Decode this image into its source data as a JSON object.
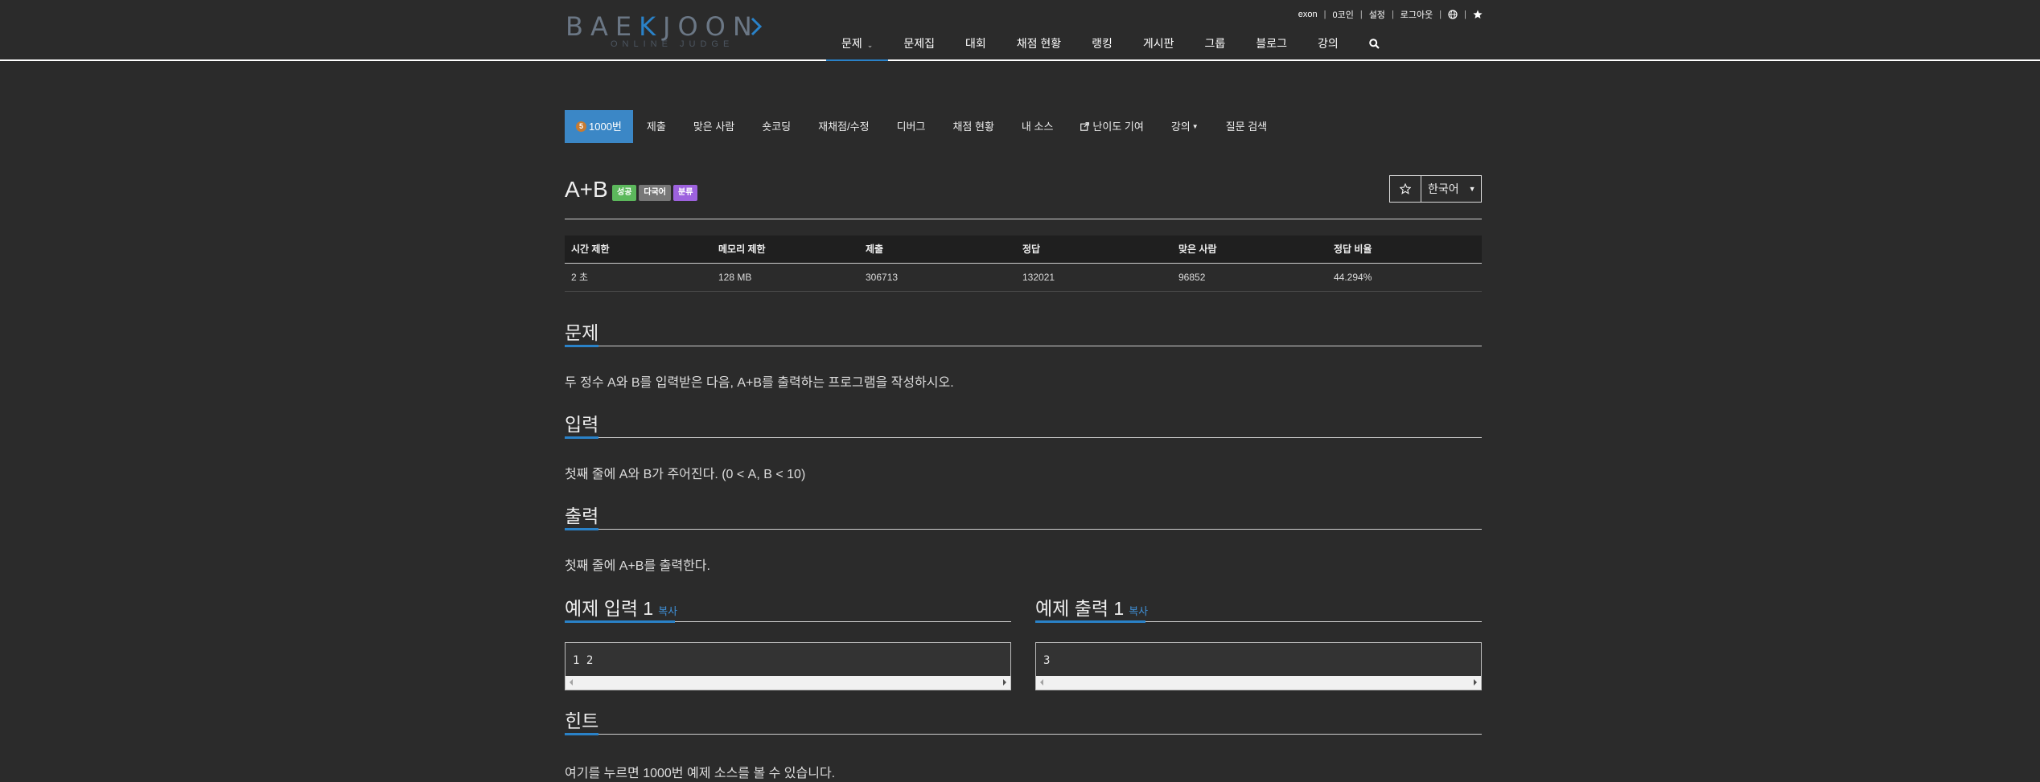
{
  "logo": {
    "text_pre": "BAE",
    "text_k": "K",
    "text_post": "JOON",
    "subtitle": "ONLINE JUDGE"
  },
  "topbar": {
    "username": "exon",
    "coins": "0코인",
    "settings": "설정",
    "logout": "로그아웃"
  },
  "nav": {
    "items": [
      {
        "label": "문제",
        "active": true,
        "dropdown": true
      },
      {
        "label": "문제집"
      },
      {
        "label": "대회"
      },
      {
        "label": "채점 현황"
      },
      {
        "label": "랭킹"
      },
      {
        "label": "게시판"
      },
      {
        "label": "그룹"
      },
      {
        "label": "블로그"
      },
      {
        "label": "강의"
      }
    ]
  },
  "subnav": {
    "active": "1000번",
    "tabs": [
      "제출",
      "맞은 사람",
      "숏코딩",
      "재채점/수정",
      "디버그",
      "채점 현황",
      "내 소스",
      "난이도 기여",
      "강의",
      "질문 검색"
    ],
    "medal_label": "5"
  },
  "problem": {
    "title": "A+B",
    "badges": [
      "성공",
      "다국어",
      "분류"
    ],
    "language": "한국어"
  },
  "info": {
    "headers": [
      "시간 제한",
      "메모리 제한",
      "제출",
      "정답",
      "맞은 사람",
      "정답 비율"
    ],
    "values": [
      "2 초",
      "128 MB",
      "306713",
      "132021",
      "96852",
      "44.294%"
    ]
  },
  "sections": {
    "problem_h": "문제",
    "problem_text": "두 정수 A와 B를 입력받은 다음, A+B를 출력하는 프로그램을 작성하시오.",
    "input_h": "입력",
    "input_text": "첫째 줄에 A와 B가 주어진다. (0 < A, B < 10)",
    "output_h": "출력",
    "output_text": "첫째 줄에 A+B를 출력한다.",
    "hint_h": "힌트",
    "hint_text": "여기를 누르면 1000번 예제 소스를 볼 수 있습니다."
  },
  "samples": {
    "input_h": "예제 입력 1",
    "output_h": "예제 출력 1",
    "copy": "복사",
    "input": "1 2",
    "output": "3"
  },
  "colors": {
    "accent": "#2a82c8",
    "active_tab": "#3b87c6",
    "success": "#5cb85c",
    "multilang": "#777777",
    "category": "#9d62de"
  }
}
